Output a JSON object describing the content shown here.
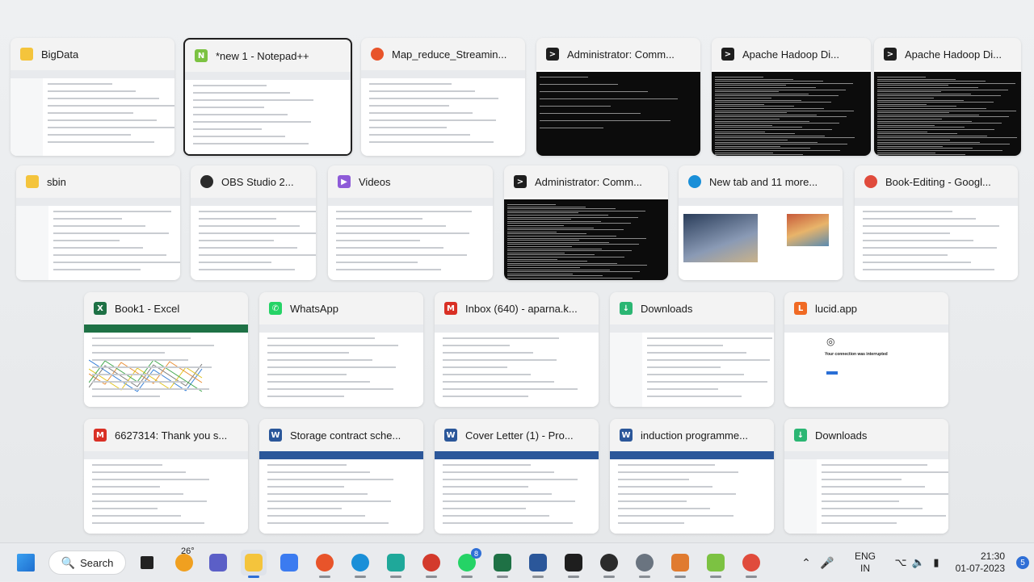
{
  "windows": [
    {
      "title": "BigData",
      "icon": "folder-icon",
      "color": "#f4c43c",
      "row": 1
    },
    {
      "title": "*new 1 - Notepad++",
      "icon": "notepadpp-icon",
      "color": "#7cc242",
      "row": 1,
      "selected": true
    },
    {
      "title": "Map_reduce_Streamin...",
      "icon": "firefox-icon",
      "color": "#e8542a",
      "row": 1
    },
    {
      "title": "Administrator: Comm...",
      "icon": "cmd-icon",
      "color": "#1e1e1e",
      "row": 1
    },
    {
      "title": "Apache Hadoop Di...",
      "icon": "cmd-icon",
      "color": "#1e1e1e",
      "row": 1
    },
    {
      "title": "Apache Hadoop Di...",
      "icon": "cmd-icon",
      "color": "#1e1e1e",
      "row": 1
    },
    {
      "title": "sbin",
      "icon": "folder-icon",
      "color": "#f4c43c",
      "row": 2
    },
    {
      "title": "OBS Studio 2...",
      "icon": "obs-icon",
      "color": "#2b2b2b",
      "row": 2
    },
    {
      "title": "Videos",
      "icon": "videos-folder-icon",
      "color": "#8e5bd8",
      "row": 2
    },
    {
      "title": "Administrator: Comm...",
      "icon": "cmd-icon",
      "color": "#1e1e1e",
      "row": 2
    },
    {
      "title": "New tab and 11 more...",
      "icon": "edge-icon",
      "color": "#1a8fd8",
      "row": 2
    },
    {
      "title": "Book-Editing - Googl...",
      "icon": "chrome-icon",
      "color": "#e04b3c",
      "row": 2
    },
    {
      "title": "Book1 - Excel",
      "icon": "excel-icon",
      "color": "#1e7145",
      "row": 3
    },
    {
      "title": "WhatsApp",
      "icon": "whatsapp-icon",
      "color": "#25d366",
      "row": 3
    },
    {
      "title": "Inbox (640) - aparna.k...",
      "icon": "gmail-icon",
      "color": "#d93025",
      "row": 3
    },
    {
      "title": "Downloads",
      "icon": "downloads-folder-icon",
      "color": "#2bb673",
      "row": 3
    },
    {
      "title": "lucid.app",
      "icon": "lucid-icon",
      "color": "#f06a24",
      "row": 3
    },
    {
      "title": "6627314: Thank you s...",
      "icon": "gmail-icon",
      "color": "#d93025",
      "row": 4
    },
    {
      "title": "Storage contract sche...",
      "icon": "word-icon",
      "color": "#2b579a",
      "row": 4
    },
    {
      "title": "Cover Letter (1)  -  Pro...",
      "icon": "word-icon",
      "color": "#2b579a",
      "row": 4
    },
    {
      "title": "induction programme...",
      "icon": "word-icon",
      "color": "#2b579a",
      "row": 4
    },
    {
      "title": "Downloads",
      "icon": "downloads-folder-icon",
      "color": "#2bb673",
      "row": 4
    }
  ],
  "thumb_text": {
    "lucid_heading": "Your connection was interrupted"
  },
  "taskbar": {
    "search_label": "Search",
    "weather_temp": "26°",
    "whatsapp_badge": "8",
    "lang_line1": "ENG",
    "lang_line2": "IN",
    "time": "21:30",
    "date": "01-07-2023",
    "notification_count": "5",
    "apps": [
      {
        "name": "start-button-icon",
        "color": "#2a7de1"
      },
      {
        "name": "task-view-icon",
        "color": "#222222"
      },
      {
        "name": "weather-icon",
        "color": "#f0a020"
      },
      {
        "name": "teams-meet-icon",
        "color": "#5b5fc7"
      },
      {
        "name": "file-explorer-icon",
        "color": "#f4c43c"
      },
      {
        "name": "arc-app-icon",
        "color": "#3b7bf0"
      },
      {
        "name": "firefox-icon",
        "color": "#e8542a"
      },
      {
        "name": "edge-icon",
        "color": "#1a8fd8"
      },
      {
        "name": "lucid-l-icon",
        "color": "#1fa89a"
      },
      {
        "name": "screen-recorder-icon",
        "color": "#d33a2c"
      },
      {
        "name": "whatsapp-icon",
        "color": "#25d366"
      },
      {
        "name": "excel-icon",
        "color": "#1e7145"
      },
      {
        "name": "word-icon",
        "color": "#2b579a"
      },
      {
        "name": "terminal-icon",
        "color": "#1e1e1e"
      },
      {
        "name": "obs-icon",
        "color": "#2b2b2b"
      },
      {
        "name": "settings-icon",
        "color": "#6a7480"
      },
      {
        "name": "loading-app-icon",
        "color": "#e07b30"
      },
      {
        "name": "notepadpp-icon",
        "color": "#7cc242"
      },
      {
        "name": "chrome-icon",
        "color": "#e04b3c"
      }
    ]
  }
}
